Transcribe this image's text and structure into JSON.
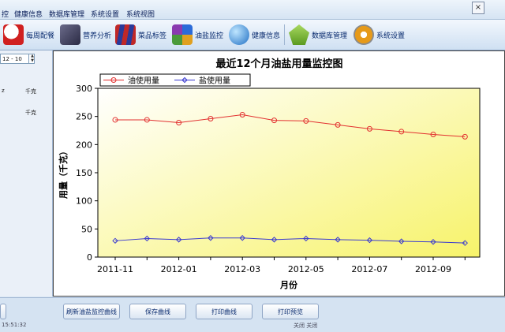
{
  "menubar": {
    "items": [
      "控",
      "健康信息",
      "数据库管理",
      "系统设置",
      "系统视图"
    ],
    "close": "×"
  },
  "toolbar": {
    "buttons": [
      {
        "label": "每周配餐",
        "icon": "chef-hat-icon"
      },
      {
        "label": "营养分析",
        "icon": "analysis-icon"
      },
      {
        "label": "菜品标签",
        "icon": "books-icon"
      },
      {
        "label": "油盐监控",
        "icon": "cubes-icon"
      },
      {
        "label": "健康信息",
        "icon": "magnifier-globe-icon"
      },
      {
        "label": "数据库管理",
        "icon": "database-icon"
      },
      {
        "label": "系统设置",
        "icon": "gear-icon"
      }
    ]
  },
  "sidebar": {
    "date_value": "12 - 10",
    "units": [
      "千克",
      "千克"
    ],
    "partial_label": "z"
  },
  "chart_data": {
    "type": "line",
    "title": "最近12个月油盐用量监控图",
    "xlabel": "月份",
    "ylabel": "用量（千克）",
    "ylim": [
      0,
      300
    ],
    "yticks": [
      0,
      50,
      100,
      150,
      200,
      250,
      300
    ],
    "x": [
      "2011-11",
      "2011-12",
      "2012-01",
      "2012-02",
      "2012-03",
      "2012-04",
      "2012-05",
      "2012-06",
      "2012-07",
      "2012-08",
      "2012-09",
      "2012-10"
    ],
    "xtick_labels": [
      "2011-11",
      "2012-01",
      "2012-03",
      "2012-05",
      "2012-07",
      "2012-09"
    ],
    "series": [
      {
        "name": "油使用量",
        "color": "#e23030",
        "values": [
          244,
          244,
          239,
          246,
          253,
          243,
          242,
          235,
          228,
          223,
          218,
          214
        ]
      },
      {
        "name": "盐使用量",
        "color": "#3a3ad0",
        "values": [
          29,
          33,
          31,
          34,
          34,
          31,
          33,
          31,
          30,
          28,
          27,
          25
        ]
      }
    ],
    "legend": "top-left",
    "grid": false,
    "background": "yellow-gradient"
  },
  "bottombar": {
    "buttons": [
      "刷新油盐监控曲线",
      "保存曲线",
      "打印曲线",
      "打印预览"
    ]
  },
  "status": {
    "left": "15:51:32",
    "right": "关闭 关闭"
  }
}
